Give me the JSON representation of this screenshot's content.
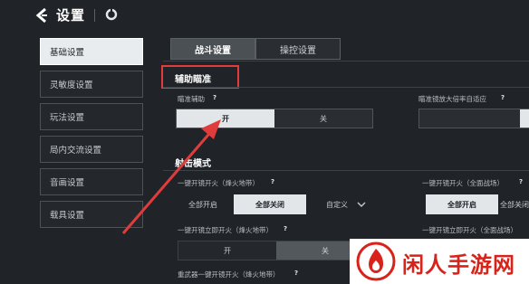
{
  "header": {
    "title": "设置",
    "back_icon": "back-chevron-icon",
    "ring_icon": "ring-icon"
  },
  "sidebar": {
    "items": [
      {
        "label": "基础设置",
        "active": true
      },
      {
        "label": "灵敏度设置",
        "active": false
      },
      {
        "label": "玩法设置",
        "active": false
      },
      {
        "label": "局内交流设置",
        "active": false
      },
      {
        "label": "音画设置",
        "active": false
      },
      {
        "label": "载具设置",
        "active": false
      }
    ]
  },
  "tabs": [
    {
      "label": "战斗设置",
      "active": true
    },
    {
      "label": "操控设置",
      "active": false
    }
  ],
  "aim_assist": {
    "section_title": "辅助瞄准",
    "aim_label": "瞄准辅助",
    "on_label": "开",
    "off_label": "关",
    "scope_adapt_label": "瞄准镜放大倍率自适应"
  },
  "fire_mode": {
    "section_title": "射击模式",
    "scope_fire_fire_zone_label": "一键开镜开火（烽火地带）",
    "scope_fire_full_label": "一键开镜开火（全面战场）",
    "all_on": "全部开启",
    "all_off": "全部关闭",
    "custom": "自定义",
    "instant_fire_fire_zone_label": "一键开镜立即开火（烽火地带）",
    "instant_fire_full_label": "一键开镜立即开火（全面战场）",
    "on_label": "开",
    "off_label": "关",
    "heavy_weapon_label": "重武器一键开镜开火（烽火地带）"
  },
  "help_glyph": "?",
  "watermark": {
    "text": "闲人手游网"
  },
  "colors": {
    "background": "#202428",
    "highlight_red": "#e03c3c",
    "selected_bg": "#e3e6e9",
    "watermark_red": "#d8231b"
  }
}
